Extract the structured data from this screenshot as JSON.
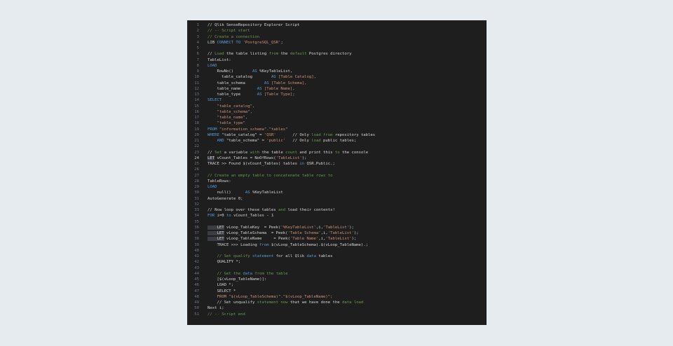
{
  "editor": {
    "language": "Qlik load script",
    "colors": {
      "background": "#1e1e1e",
      "line_number": "#6e7681",
      "text": "#d4d4d4",
      "comment": "#6a9955",
      "keyword": "#569cd6",
      "string": "#ce9178",
      "function": "#dcdcaa"
    },
    "active_line": 24,
    "lines": [
      {
        "n": "1",
        "tokens": [
          {
            "t": "// Qlik SenseRepository Explorer Script",
            "c": "plain"
          }
        ]
      },
      {
        "n": "2",
        "tokens": [
          {
            "t": "// -- Script start",
            "c": "comment"
          }
        ]
      },
      {
        "n": "3",
        "tokens": [
          {
            "t": "// Create a connection",
            "c": "comment"
          }
        ]
      },
      {
        "n": "4",
        "tokens": [
          {
            "t": "LIB ",
            "c": "plain"
          },
          {
            "t": "CONNECT TO",
            "c": "kw"
          },
          {
            "t": " ",
            "c": "plain"
          },
          {
            "t": "'PostgreSQL_QSR'",
            "c": "str"
          },
          {
            "t": ";",
            "c": "plain"
          }
        ]
      },
      {
        "n": "5",
        "tokens": []
      },
      {
        "n": "6",
        "tokens": [
          {
            "t": "// ",
            "c": "plain"
          },
          {
            "t": "Load",
            "c": "comment"
          },
          {
            "t": " the table listing ",
            "c": "plain"
          },
          {
            "t": "from",
            "c": "comment"
          },
          {
            "t": " the ",
            "c": "plain"
          },
          {
            "t": "default",
            "c": "comment"
          },
          {
            "t": " Postgres directory",
            "c": "plain"
          }
        ]
      },
      {
        "n": "7",
        "tokens": [
          {
            "t": "TableList:",
            "c": "plain"
          }
        ]
      },
      {
        "n": "8",
        "tokens": [
          {
            "t": "LOAD",
            "c": "kw"
          }
        ]
      },
      {
        "n": "9",
        "tokens": [
          {
            "t": "    RowNo()        ",
            "c": "plain"
          },
          {
            "t": "AS",
            "c": "kw"
          },
          {
            "t": " %KeyTableList,",
            "c": "plain"
          }
        ]
      },
      {
        "n": "10",
        "tokens": [
          {
            "t": "      table_catalog        ",
            "c": "plain"
          },
          {
            "t": "AS",
            "c": "kw"
          },
          {
            "t": " [Table Catalog],",
            "c": "str"
          }
        ]
      },
      {
        "n": "11",
        "tokens": [
          {
            "t": "    table_schema        ",
            "c": "plain"
          },
          {
            "t": "AS",
            "c": "kw"
          },
          {
            "t": " [Table Schema],",
            "c": "str"
          }
        ]
      },
      {
        "n": "12",
        "tokens": [
          {
            "t": "    table_name       ",
            "c": "plain"
          },
          {
            "t": "AS",
            "c": "kw"
          },
          {
            "t": " [Table Name],",
            "c": "str"
          }
        ]
      },
      {
        "n": "13",
        "tokens": [
          {
            "t": "    table_type       ",
            "c": "plain"
          },
          {
            "t": "AS",
            "c": "kw"
          },
          {
            "t": " [Table Type];",
            "c": "str"
          }
        ]
      },
      {
        "n": "14",
        "tokens": [
          {
            "t": "SELECT",
            "c": "kw"
          }
        ]
      },
      {
        "n": "15",
        "tokens": [
          {
            "t": "    \"table_catalog\",",
            "c": "str"
          }
        ]
      },
      {
        "n": "16",
        "tokens": [
          {
            "t": "    \"table_schema\",",
            "c": "str"
          }
        ]
      },
      {
        "n": "17",
        "tokens": [
          {
            "t": "    \"table_name\",",
            "c": "str"
          }
        ]
      },
      {
        "n": "18",
        "tokens": [
          {
            "t": "    \"table_type\"",
            "c": "str"
          }
        ]
      },
      {
        "n": "19",
        "tokens": [
          {
            "t": "FROM",
            "c": "kw"
          },
          {
            "t": " \"information_schema\".\"tables\"",
            "c": "str"
          }
        ]
      },
      {
        "n": "20",
        "tokens": [
          {
            "t": "WHERE",
            "c": "kw"
          },
          {
            "t": " \"table_catalog\" = ",
            "c": "plain"
          },
          {
            "t": "'QSR'",
            "c": "str"
          },
          {
            "t": "       // Only ",
            "c": "plain"
          },
          {
            "t": "load from",
            "c": "comment"
          },
          {
            "t": " repository tables",
            "c": "plain"
          }
        ]
      },
      {
        "n": "21",
        "tokens": [
          {
            "t": "    AND",
            "c": "kw"
          },
          {
            "t": " \"table_schema\" = ",
            "c": "plain"
          },
          {
            "t": "'public'",
            "c": "str"
          },
          {
            "t": "   // Only ",
            "c": "plain"
          },
          {
            "t": "load",
            "c": "comment"
          },
          {
            "t": " public tables;",
            "c": "plain"
          }
        ]
      },
      {
        "n": "22",
        "tokens": []
      },
      {
        "n": "23",
        "tokens": [
          {
            "t": "// ",
            "c": "plain"
          },
          {
            "t": "Set",
            "c": "comment"
          },
          {
            "t": " a variable ",
            "c": "plain"
          },
          {
            "t": "with",
            "c": "comment"
          },
          {
            "t": " the table ",
            "c": "plain"
          },
          {
            "t": "count",
            "c": "comment"
          },
          {
            "t": " and print this ",
            "c": "plain"
          },
          {
            "t": "to",
            "c": "comment"
          },
          {
            "t": " the console",
            "c": "plain"
          }
        ]
      },
      {
        "n": "24",
        "tokens": [
          {
            "t": "LET",
            "c": "hl"
          },
          {
            "t": " vCount_Tables = NoOfRows(",
            "c": "plain"
          },
          {
            "t": "'TableList'",
            "c": "str"
          },
          {
            "t": ");",
            "c": "plain"
          }
        ]
      },
      {
        "n": "25",
        "tokens": [
          {
            "t": "TRACE >> Found $(vCount_Tables) tables ",
            "c": "plain"
          },
          {
            "t": "in",
            "c": "kw"
          },
          {
            "t": " QSR.Public.;",
            "c": "plain"
          }
        ]
      },
      {
        "n": "26",
        "tokens": []
      },
      {
        "n": "27",
        "tokens": [
          {
            "t": "// Create an empty table to concatenate table rows to",
            "c": "comment"
          }
        ]
      },
      {
        "n": "28",
        "tokens": [
          {
            "t": "TableRows:",
            "c": "plain"
          }
        ]
      },
      {
        "n": "29",
        "tokens": [
          {
            "t": "LOAD",
            "c": "kw"
          }
        ]
      },
      {
        "n": "30",
        "tokens": [
          {
            "t": "    null()      ",
            "c": "plain"
          },
          {
            "t": "AS",
            "c": "kw"
          },
          {
            "t": " %KeyTableList",
            "c": "plain"
          }
        ]
      },
      {
        "n": "31",
        "tokens": [
          {
            "t": "AutoGenerate 0;",
            "c": "plain"
          }
        ]
      },
      {
        "n": "32",
        "tokens": []
      },
      {
        "n": "33",
        "tokens": [
          {
            "t": "// Now loop over these tables ",
            "c": "plain"
          },
          {
            "t": "and",
            "c": "comment"
          },
          {
            "t": " load their contents!",
            "c": "plain"
          }
        ]
      },
      {
        "n": "34",
        "tokens": [
          {
            "t": "FOR",
            "c": "kw"
          },
          {
            "t": " i=0 ",
            "c": "plain"
          },
          {
            "t": "to",
            "c": "kw"
          },
          {
            "t": " vCount_Tables - 1",
            "c": "plain"
          }
        ]
      },
      {
        "n": "35",
        "tokens": []
      },
      {
        "n": "36",
        "tokens": [
          {
            "t": "    LET",
            "c": "hl"
          },
          {
            "t": " vLoop_TableKey  = Peek(",
            "c": "plain"
          },
          {
            "t": "'%KeyTableList'",
            "c": "str"
          },
          {
            "t": ",i,",
            "c": "plain"
          },
          {
            "t": "'TableList'",
            "c": "str"
          },
          {
            "t": ");",
            "c": "plain"
          }
        ]
      },
      {
        "n": "37",
        "tokens": [
          {
            "t": "    LET",
            "c": "hl"
          },
          {
            "t": " vLoop_TableSchema  = Peek(",
            "c": "plain"
          },
          {
            "t": "'Table Schema'",
            "c": "str"
          },
          {
            "t": ",i,",
            "c": "plain"
          },
          {
            "t": "'TableList'",
            "c": "str"
          },
          {
            "t": ");",
            "c": "plain"
          }
        ]
      },
      {
        "n": "38",
        "tokens": [
          {
            "t": "    LET",
            "c": "hl"
          },
          {
            "t": " vLoop_TableName     = Peek(",
            "c": "plain"
          },
          {
            "t": "'Table Name'",
            "c": "str"
          },
          {
            "t": ",i,",
            "c": "plain"
          },
          {
            "t": "'TableList'",
            "c": "str"
          },
          {
            "t": ");",
            "c": "plain"
          }
        ]
      },
      {
        "n": "39",
        "tokens": [
          {
            "t": "    TRACE >>> Loading ",
            "c": "plain"
          },
          {
            "t": "from",
            "c": "kw"
          },
          {
            "t": " $(vLoop_TableSchema).$(vLoop_TableName).;",
            "c": "plain"
          }
        ]
      },
      {
        "n": "40",
        "tokens": []
      },
      {
        "n": "41",
        "tokens": [
          {
            "t": "    // Set qualify ",
            "c": "comment"
          },
          {
            "t": "statement",
            "c": "kw"
          },
          {
            "t": " for all Qlik ",
            "c": "plain"
          },
          {
            "t": "data",
            "c": "kw"
          },
          {
            "t": " tables",
            "c": "plain"
          }
        ]
      },
      {
        "n": "42",
        "tokens": [
          {
            "t": "    QUALIFY *;",
            "c": "plain"
          }
        ]
      },
      {
        "n": "43",
        "tokens": []
      },
      {
        "n": "44",
        "tokens": [
          {
            "t": "    // Get the ",
            "c": "comment"
          },
          {
            "t": "data",
            "c": "kw"
          },
          {
            "t": " from the table",
            "c": "comment"
          }
        ]
      },
      {
        "n": "45",
        "tokens": [
          {
            "t": "    [$(vLoop_TableName)]:",
            "c": "plain"
          }
        ]
      },
      {
        "n": "46",
        "tokens": [
          {
            "t": "    LOAD *;",
            "c": "plain"
          }
        ]
      },
      {
        "n": "47",
        "tokens": [
          {
            "t": "    SELECT *",
            "c": "plain"
          }
        ]
      },
      {
        "n": "48",
        "tokens": [
          {
            "t": "    FROM \"$(vLoop_TableSchema)\".\"$(vLoop_TableName)\";",
            "c": "str"
          }
        ]
      },
      {
        "n": "49",
        "tokens": [
          {
            "t": "    // Set unqualify ",
            "c": "plain"
          },
          {
            "t": "statement now",
            "c": "comment"
          },
          {
            "t": " that we have done the ",
            "c": "plain"
          },
          {
            "t": "data load",
            "c": "comment"
          }
        ]
      },
      {
        "n": "50",
        "tokens": [
          {
            "t": "Next i;",
            "c": "plain"
          }
        ]
      },
      {
        "n": "51",
        "tokens": [
          {
            "t": "// -- Script end",
            "c": "comment"
          }
        ]
      }
    ]
  }
}
